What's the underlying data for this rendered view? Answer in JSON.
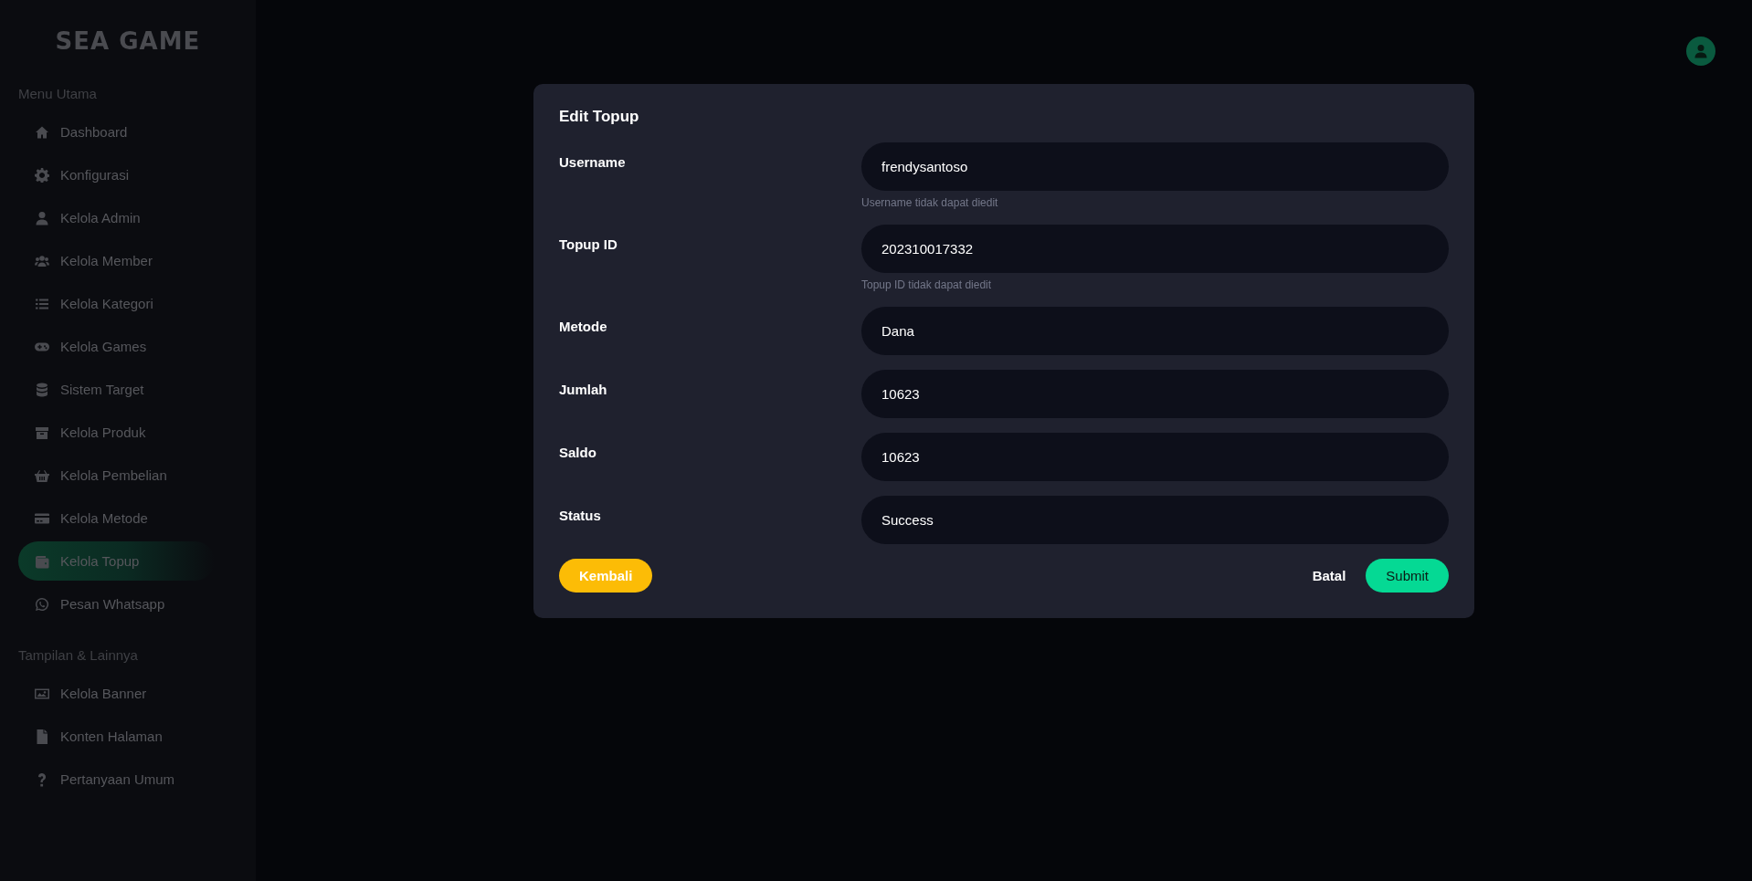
{
  "sidebar": {
    "logo": "SEA GAME",
    "sections": [
      {
        "title": "Menu Utama",
        "items": [
          {
            "label": "Dashboard",
            "selected": false
          },
          {
            "label": "Konfigurasi",
            "selected": false
          },
          {
            "label": "Kelola Admin",
            "selected": false
          },
          {
            "label": "Kelola Member",
            "selected": false
          },
          {
            "label": "Kelola Kategori",
            "selected": false
          },
          {
            "label": "Kelola Games",
            "selected": false
          },
          {
            "label": "Sistem Target",
            "selected": false
          },
          {
            "label": "Kelola Produk",
            "selected": false
          },
          {
            "label": "Kelola Pembelian",
            "selected": false
          },
          {
            "label": "Kelola Metode",
            "selected": false
          },
          {
            "label": "Kelola Topup",
            "selected": true
          },
          {
            "label": "Pesan Whatsapp",
            "selected": false
          }
        ]
      },
      {
        "title": "Tampilan & Lainnya",
        "items": [
          {
            "label": "Kelola Banner",
            "selected": false
          },
          {
            "label": "Konten Halaman",
            "selected": false
          },
          {
            "label": "Pertanyaan Umum",
            "selected": false
          }
        ]
      }
    ]
  },
  "modal": {
    "title": "Edit Topup",
    "fields": [
      {
        "label": "Username",
        "value": "frendysantoso",
        "helper": "Username tidak dapat diedit"
      },
      {
        "label": "Topup ID",
        "value": "202310017332",
        "helper": "Topup ID tidak dapat diedit"
      },
      {
        "label": "Metode",
        "value": "Dana"
      },
      {
        "label": "Jumlah",
        "value": "10623"
      },
      {
        "label": "Saldo",
        "value": "10623"
      },
      {
        "label": "Status",
        "value": "Success"
      }
    ],
    "back_button": "Kembali",
    "cancel_button": "Batal",
    "submit_button": "Submit"
  }
}
